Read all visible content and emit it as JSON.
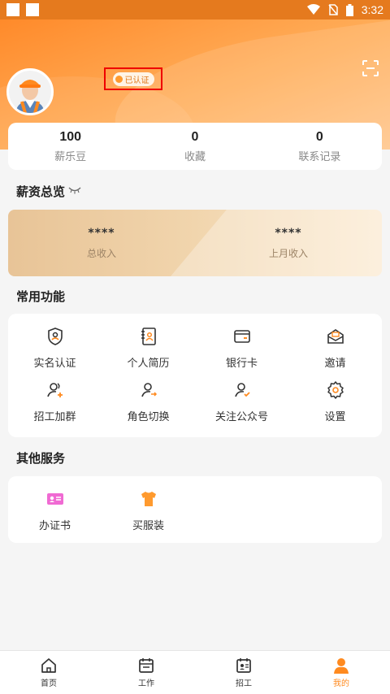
{
  "status_bar": {
    "time": "3:32"
  },
  "profile": {
    "cert_label": "已认证"
  },
  "stats": [
    {
      "value": "100",
      "label": "薪乐豆"
    },
    {
      "value": "0",
      "label": "收藏"
    },
    {
      "value": "0",
      "label": "联系记录"
    }
  ],
  "salary": {
    "title": "薪资总览",
    "total": {
      "value": "****",
      "label": "总收入"
    },
    "last_month": {
      "value": "****",
      "label": "上月收入"
    }
  },
  "functions": {
    "title": "常用功能",
    "items": [
      {
        "label": "实名认证",
        "icon": "shield-user-icon"
      },
      {
        "label": "个人简历",
        "icon": "resume-icon"
      },
      {
        "label": "银行卡",
        "icon": "wallet-icon"
      },
      {
        "label": "邀请",
        "icon": "envelope-icon"
      },
      {
        "label": "招工加群",
        "icon": "user-group-add-icon"
      },
      {
        "label": "角色切换",
        "icon": "user-switch-icon"
      },
      {
        "label": "关注公众号",
        "icon": "user-follow-icon"
      },
      {
        "label": "设置",
        "icon": "gear-icon"
      }
    ]
  },
  "other_services": {
    "title": "其他服务",
    "items": [
      {
        "label": "办证书",
        "icon": "id-card-icon"
      },
      {
        "label": "买服装",
        "icon": "shirt-icon"
      }
    ]
  },
  "tabs": [
    {
      "label": "首页",
      "icon": "home-icon"
    },
    {
      "label": "工作",
      "icon": "calendar-icon"
    },
    {
      "label": "招工",
      "icon": "hiring-icon"
    },
    {
      "label": "我的",
      "icon": "profile-icon",
      "active": true
    }
  ],
  "colors": {
    "accent": "#ff8a1f",
    "header_start": "#ff8a2a",
    "header_end": "#ffc58a"
  }
}
